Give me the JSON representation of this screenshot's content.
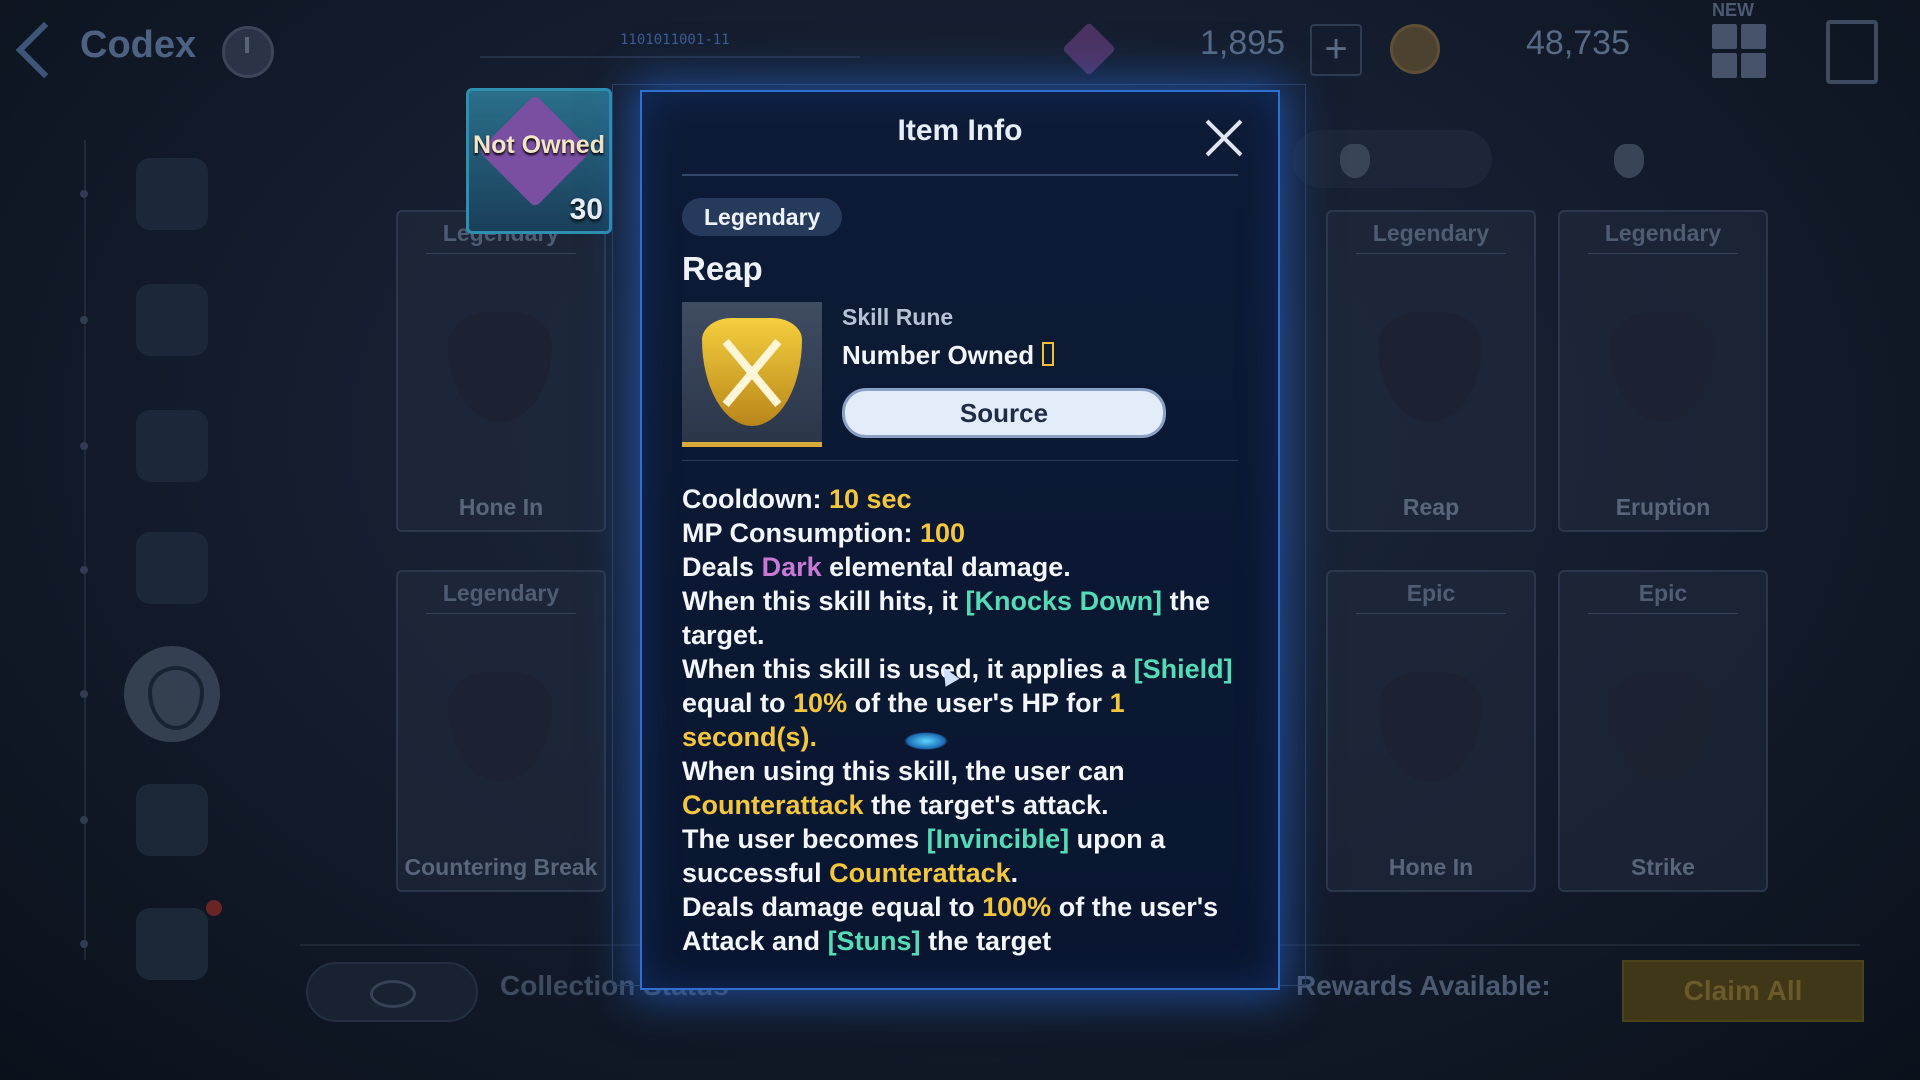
{
  "header": {
    "title": "Codex",
    "serial": "1101011001-11",
    "currency_gems": "1,895",
    "currency_coins": "48,735",
    "new_badge": "NEW"
  },
  "background_cards": [
    {
      "rarity": "Legendary",
      "name": "Hone In"
    },
    {
      "rarity": "Legendary",
      "name": "Reap"
    },
    {
      "rarity": "Legendary",
      "name": "Eruption"
    },
    {
      "rarity": "Legendary",
      "name": "Countering Break"
    },
    {
      "rarity": "Epic",
      "name": "Hone In"
    },
    {
      "rarity": "Epic",
      "name": "Strike"
    }
  ],
  "not_owned_card": {
    "label": "Not Owned",
    "count": "30"
  },
  "bottom_bar": {
    "collection_label": "Collection Status",
    "rewards_label": "Rewards Available:",
    "claim_all": "Claim All"
  },
  "modal": {
    "title": "Item Info",
    "rarity": "Legendary",
    "item_name": "Reap",
    "item_type": "Skill Rune",
    "number_owned_label": "Number Owned",
    "source_button": "Source",
    "description": {
      "cooldown_label": "Cooldown:",
      "cooldown_value": "10 sec",
      "mp_label": "MP Consumption:",
      "mp_value": "100",
      "line3_a": "Deals",
      "line3_element": "Dark",
      "line3_b": "elemental damage.",
      "line4_a": "When this skill hits, it",
      "line4_effect": "[Knocks Down]",
      "line4_b": "the target.",
      "line5_a": "When this skill is used, it applies a",
      "line5_effect": "[Shield]",
      "line5_b": "equal to",
      "line5_pct": "10%",
      "line5_c": "of the user's HP for",
      "line5_dur": "1 second(s).",
      "line6_a": "When using this skill, the user can",
      "line6_counter": "Counterattack",
      "line6_b": "the target's attack.",
      "line7_a": "The user becomes",
      "line7_effect": "[Invincible]",
      "line7_b": "upon a successful",
      "line7_counter": "Counterattack",
      "line7_c": ".",
      "line8_a": "Deals damage equal to",
      "line8_pct": "100%",
      "line8_b": "of the user's Attack and",
      "line8_effect": "[Stuns]",
      "line8_c": "the target"
    }
  },
  "colors": {
    "accent_blue": "#2e6fd0",
    "highlight_yellow": "#f4c63d",
    "highlight_green": "#54dcb6",
    "element_dark": "#c879d6"
  }
}
